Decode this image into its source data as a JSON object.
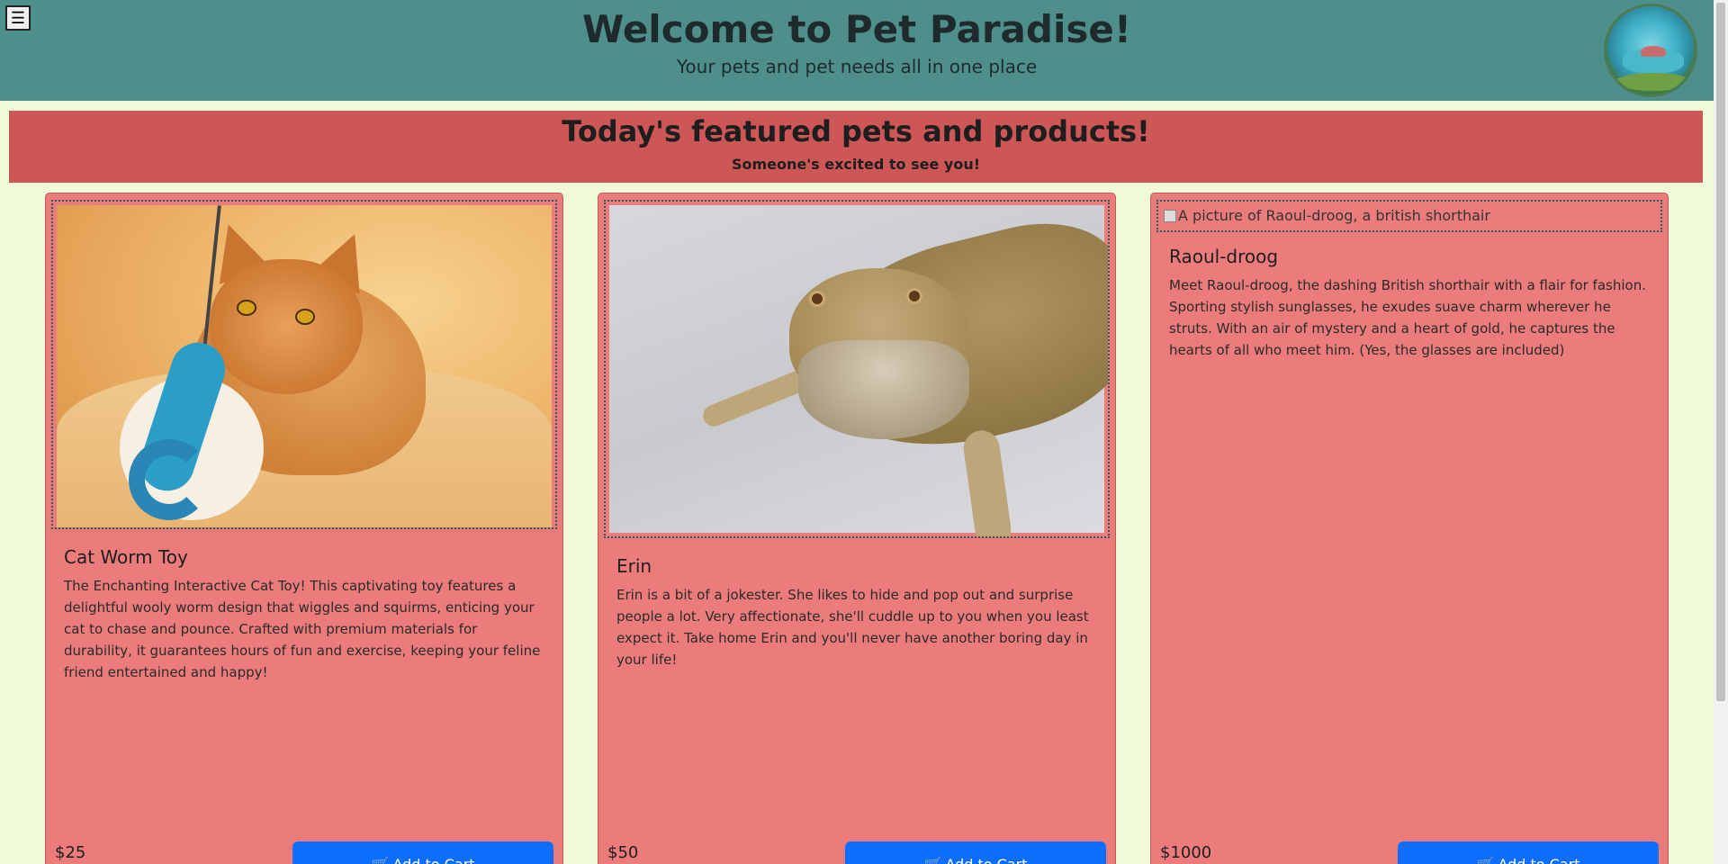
{
  "header": {
    "menu_glyph": "☰",
    "title": "Welcome to Pet Paradise!",
    "subtitle": "Your pets and pet needs all in one place"
  },
  "featured": {
    "title": "Today's featured pets and products!",
    "subtitle": "Someone's excited to see you!"
  },
  "cards": [
    {
      "name": "Cat Worm Toy",
      "description": "The Enchanting Interactive Cat Toy! This captivating toy features a delightful wooly worm design that wiggles and squirms, enticing your cat to chase and pounce. Crafted with premium materials for durability, it guarantees hours of fun and exercise, keeping your feline friend entertained and happy!",
      "price": "$25",
      "button_label": "Add to Cart"
    },
    {
      "name": "Erin",
      "description": "Erin is a bit of a jokester. She likes to hide and pop out and surprise people a lot. Very affectionate, she'll cuddle up to you when you least expect it. Take home Erin and you'll never have another boring day in your life!",
      "price": "$50",
      "button_label": "Add to Cart"
    },
    {
      "name": "Raoul-droog",
      "image_alt": "A picture of Raoul-droog, a british shorthair",
      "description": "Meet Raoul-droog, the dashing British shorthair with a flair for fashion. Sporting stylish sunglasses, he exudes suave charm wherever he struts. With an air of mystery and a heart of gold, he captures the hearts of all who meet him. (Yes, the glasses are included)",
      "price": "$1000",
      "button_label": "Add to Cart"
    }
  ],
  "icons": {
    "cart": "cart-icon",
    "menu": "menu-icon",
    "logo": "logo-globe"
  },
  "colors": {
    "header_bg": "#4e8f8c",
    "page_bg": "#eefad8",
    "featured_bg": "#cd5656",
    "card_bg": "#ec7c7c",
    "button_bg": "#0d6efd"
  }
}
